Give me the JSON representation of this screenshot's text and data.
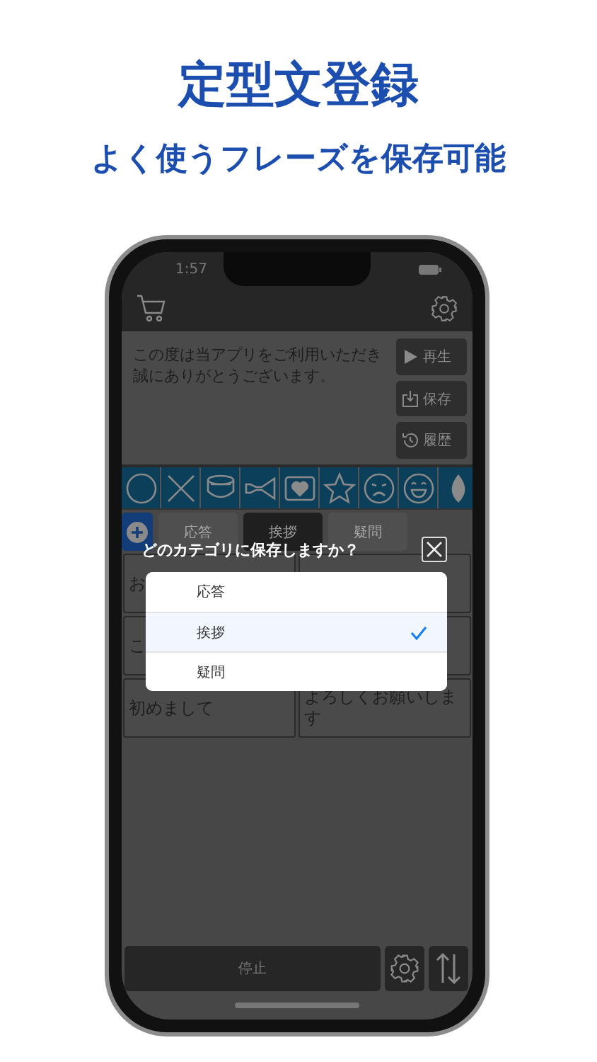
{
  "header": {
    "title": "定型文登録",
    "subtitle": "よく使うフレーズを保存可能"
  },
  "status_bar": {
    "time": "1:57"
  },
  "message_lines": [
    "この度は当アプリをご利用いただき",
    "誠にありがとうございます。"
  ],
  "actions": [
    {
      "label": "再生"
    },
    {
      "label": "保存"
    },
    {
      "label": "履歴"
    }
  ],
  "stamps": [
    {
      "kind": "circle"
    },
    {
      "kind": "cross"
    },
    {
      "kind": "drum"
    },
    {
      "kind": "horn"
    },
    {
      "kind": "heart"
    },
    {
      "kind": "star"
    },
    {
      "kind": "sad"
    },
    {
      "kind": "smile"
    },
    {
      "kind": "drop"
    }
  ],
  "tabs": [
    {
      "label": "応答",
      "selected": false
    },
    {
      "label": "挨拶",
      "selected": true
    },
    {
      "label": "疑問",
      "selected": false
    }
  ],
  "phrases": [
    {
      "left": "お"
    },
    {
      "left": "こ"
    },
    {
      "left": "初めまして",
      "right": "よろしくお願いします"
    }
  ],
  "dialog": {
    "title": "どのカテゴリに保存しますか？",
    "options": [
      {
        "label": "応答",
        "selected": false
      },
      {
        "label": "挨拶",
        "selected": true
      },
      {
        "label": "疑問",
        "selected": false
      }
    ]
  },
  "bottom_bar": {
    "stop": "停止"
  }
}
